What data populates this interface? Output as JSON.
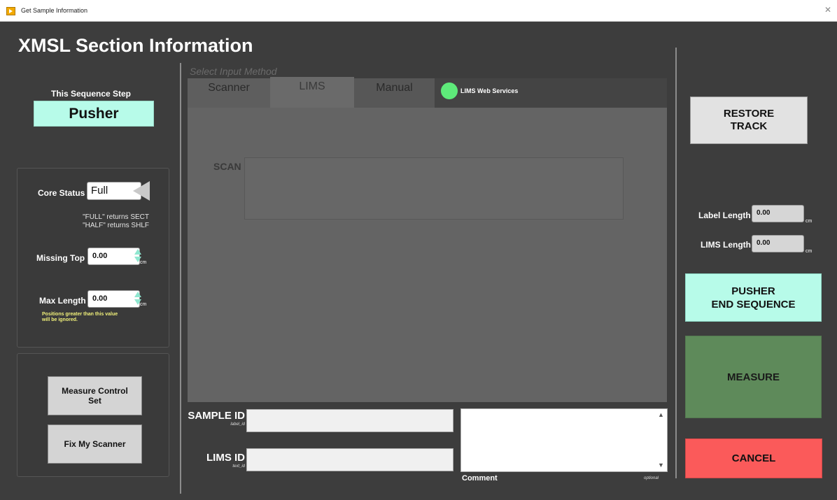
{
  "window": {
    "title": "Get Sample Information"
  },
  "header": {
    "title": "XMSL Section Information"
  },
  "sequence": {
    "label": "This Sequence Step",
    "value": "Pusher"
  },
  "core_status": {
    "label": "Core Status",
    "value": "Full",
    "hint_line1": "\"FULL\" returns SECT",
    "hint_line2": "\"HALF\" returns SHLF"
  },
  "missing_top": {
    "label": "Missing Top",
    "value": "0.00",
    "unit": "cm"
  },
  "max_length": {
    "label": "Max Length",
    "value": "0.00",
    "unit": "cm",
    "warn_line1": "Positions greater than this value",
    "warn_line2": "will be ignored."
  },
  "buttons_left": {
    "measure_control_line1": "Measure Control",
    "measure_control_line2": "Set",
    "fix_scanner": "Fix My Scanner"
  },
  "input_method": {
    "label": "Select Input Method",
    "tabs": [
      "Scanner",
      "LIMS",
      "Manual"
    ],
    "lims_status_label": "LIMS Web Services",
    "lims_status_color": "#5eea7a",
    "scan_label": "SCAN"
  },
  "sample_id": {
    "label": "SAMPLE ID",
    "sub": "label_id",
    "value": ""
  },
  "lims_id": {
    "label": "LIMS ID",
    "sub": "text_id",
    "value": ""
  },
  "comment": {
    "label": "Comment",
    "optional": "optional",
    "value": ""
  },
  "right": {
    "restore_line1": "RESTORE",
    "restore_line2": "TRACK",
    "label_length": {
      "label": "Label Length",
      "value": "0.00",
      "unit": "cm"
    },
    "lims_length": {
      "label": "LIMS Length",
      "value": "0.00",
      "unit": "cm"
    },
    "pusher_line1": "PUSHER",
    "pusher_line2": "END SEQUENCE",
    "measure": "MEASURE",
    "cancel": "CANCEL"
  }
}
